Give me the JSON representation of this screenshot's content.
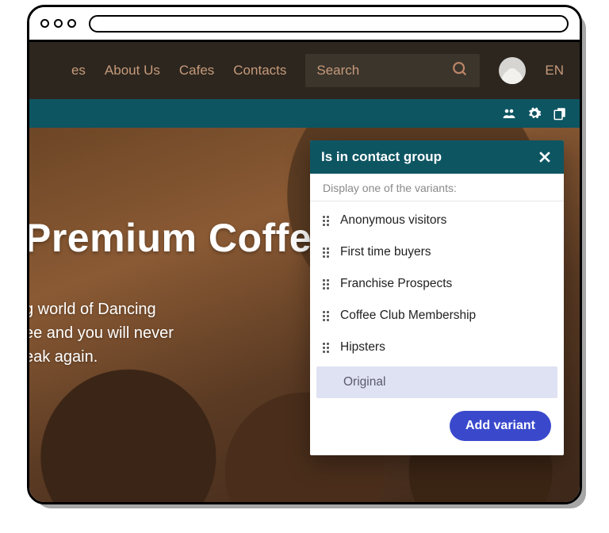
{
  "nav": {
    "partial": "es",
    "links": [
      "About Us",
      "Cafes",
      "Contacts"
    ]
  },
  "search": {
    "placeholder": "Search"
  },
  "lang": "EN",
  "panel": {
    "title": "Is in contact group",
    "subtitle": "Display one of the variants:",
    "variants": [
      "Anonymous visitors",
      "First time buyers",
      "Franchise Prospects",
      "Coffee Club Membership",
      "Hipsters"
    ],
    "selected": "Original",
    "addButton": "Add variant"
  },
  "hero": {
    "title": "Premium Coffee",
    "line1": "g world of Dancing",
    "line2": "ee and you will never",
    "line3": "eak again."
  }
}
